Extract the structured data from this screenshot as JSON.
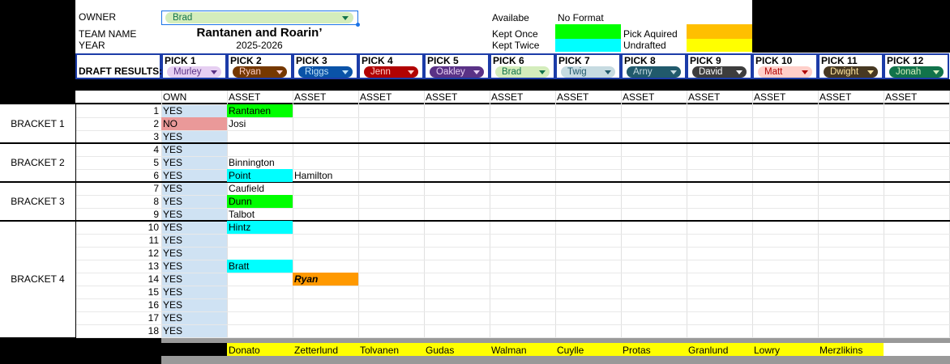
{
  "owner": {
    "label": "OWNER",
    "value": "Brad"
  },
  "team": {
    "label": "TEAM NAME",
    "name": "Rantanen and Roarin’"
  },
  "year": {
    "label": "YEAR",
    "value": "2025-2026"
  },
  "legend": {
    "available": "Availabe",
    "no_format": "No Format",
    "kept_once": "Kept Once",
    "kept_twice": "Kept Twice",
    "pick_acquired": "Pick Aquired",
    "undrafted": "Undrafted",
    "colors": {
      "kept_once": "#00ff00",
      "kept_twice": "#00ffff",
      "pick_acquired": "#ffbf00",
      "undrafted": "#ffff00"
    }
  },
  "draft": {
    "label": "DRAFT RESULTS:",
    "picks": [
      {
        "pick": "PICK 1",
        "owner": "Murley",
        "bg": "#e6cff2",
        "fg": "#5a3286"
      },
      {
        "pick": "PICK 2",
        "owner": "Ryan",
        "bg": "#753800",
        "fg": "#ffcfc9"
      },
      {
        "pick": "PICK 3",
        "owner": "Riggs",
        "bg": "#0a53a8",
        "fg": "#bfe1f6"
      },
      {
        "pick": "PICK 4",
        "owner": "Jenn",
        "bg": "#b10202",
        "fg": "#ffcfc9"
      },
      {
        "pick": "PICK 5",
        "owner": "Oakley",
        "bg": "#5a3286",
        "fg": "#e6cff2"
      },
      {
        "pick": "PICK 6",
        "owner": "Brad",
        "bg": "#d4edbc",
        "fg": "#11734b"
      },
      {
        "pick": "PICK 7",
        "owner": "Twig",
        "bg": "#c6dbe1",
        "fg": "#215a6c"
      },
      {
        "pick": "PICK 8",
        "owner": "Arny",
        "bg": "#215a6c",
        "fg": "#c6dbe1"
      },
      {
        "pick": "PICK 9",
        "owner": "David",
        "bg": "#3d3d3d",
        "fg": "#ffffff"
      },
      {
        "pick": "PICK 10",
        "owner": "Matt",
        "bg": "#ffcfc9",
        "fg": "#b10202"
      },
      {
        "pick": "PICK 11",
        "owner": "Dwight",
        "bg": "#473822",
        "fg": "#ffe5a0"
      },
      {
        "pick": "PICK 12",
        "owner": "Jonah",
        "bg": "#11734b",
        "fg": "#d4edbc"
      }
    ]
  },
  "grid": {
    "own_header": "OWN",
    "asset_header": "ASSET",
    "brackets": [
      "BRACKET 1",
      "BRACKET 2",
      "BRACKET 3",
      "BRACKET 4"
    ],
    "rows": [
      {
        "n": "1",
        "own": "YES",
        "assets": [
          {
            "col": 0,
            "text": "Rantanen",
            "bg": "#00ff00"
          }
        ]
      },
      {
        "n": "2",
        "own": "NO",
        "own_bg": "#ea9999",
        "assets": [
          {
            "col": 0,
            "text": "Josi"
          }
        ]
      },
      {
        "n": "3",
        "own": "YES",
        "assets": []
      },
      {
        "n": "4",
        "own": "YES",
        "assets": []
      },
      {
        "n": "5",
        "own": "YES",
        "assets": [
          {
            "col": 0,
            "text": "Binnington"
          }
        ]
      },
      {
        "n": "6",
        "own": "YES",
        "assets": [
          {
            "col": 0,
            "text": "Point",
            "bg": "#00ffff"
          },
          {
            "col": 1,
            "text": "Hamilton"
          }
        ]
      },
      {
        "n": "7",
        "own": "YES",
        "assets": [
          {
            "col": 0,
            "text": "Caufield"
          }
        ]
      },
      {
        "n": "8",
        "own": "YES",
        "assets": [
          {
            "col": 0,
            "text": "Dunn",
            "bg": "#00ff00"
          }
        ]
      },
      {
        "n": "9",
        "own": "YES",
        "assets": [
          {
            "col": 0,
            "text": "Talbot"
          }
        ]
      },
      {
        "n": "10",
        "own": "YES",
        "assets": [
          {
            "col": 0,
            "text": "Hintz",
            "bg": "#00ffff"
          }
        ]
      },
      {
        "n": "11",
        "own": "YES",
        "assets": []
      },
      {
        "n": "12",
        "own": "YES",
        "assets": []
      },
      {
        "n": "13",
        "own": "YES",
        "assets": [
          {
            "col": 0,
            "text": "Bratt",
            "bg": "#00ffff"
          }
        ]
      },
      {
        "n": "14",
        "own": "YES",
        "assets": [
          {
            "col": 1,
            "text": "Ryan",
            "bg": "#ff9900",
            "bold": true
          }
        ]
      },
      {
        "n": "15",
        "own": "YES",
        "assets": []
      },
      {
        "n": "16",
        "own": "YES",
        "assets": []
      },
      {
        "n": "17",
        "own": "YES",
        "assets": []
      },
      {
        "n": "18",
        "own": "YES",
        "assets": []
      }
    ]
  },
  "undrafted": {
    "label": "UNDRAFTED",
    "players": [
      "Donato",
      "Zetterlund",
      "Tolvanen",
      "Gudas",
      "Walman",
      "Cuylle",
      "Protas",
      "Granlund",
      "Lowry",
      "Merzlikins"
    ]
  }
}
